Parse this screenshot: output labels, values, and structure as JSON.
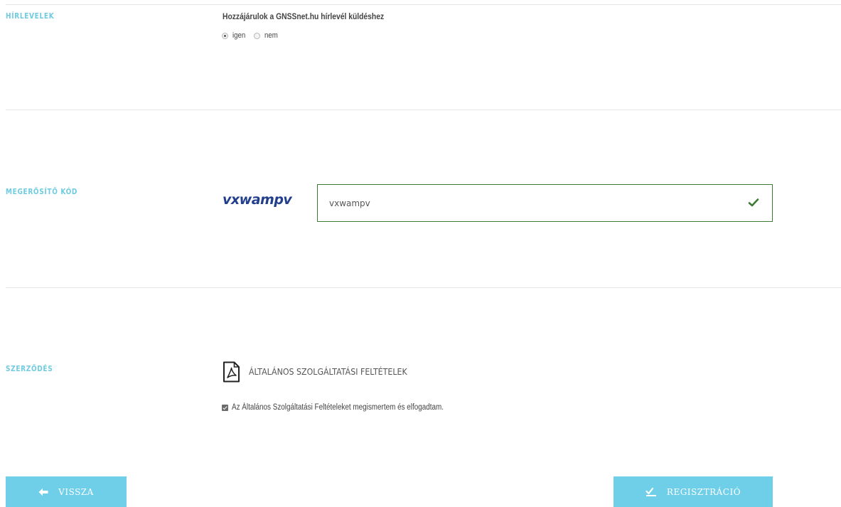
{
  "sections": {
    "newsletter": {
      "title": "HÍRLEVELEK",
      "consent_label": "Hozzájárulok a GNSSnet.hu hírlevél küldéshez",
      "options": [
        "igen",
        "nem"
      ],
      "selected": "igen"
    },
    "captcha": {
      "title": "MEGERŐSÍTŐ KÓD",
      "image_text": "vxwampv",
      "input_value": "vxwampv",
      "valid": true,
      "icon": "check-icon"
    },
    "contract": {
      "title": "SZERZŐDÉS",
      "terms_link": "ÁLTALÁNOS SZOLGÁLTATÁSI FELTÉTELEK",
      "terms_icon": "pdf-icon",
      "accept_label": "Az Általános Szolgáltatási Feltételeket megismertem és elfogadtam.",
      "accepted": true
    }
  },
  "buttons": {
    "back_label": "VISSZA",
    "back_icon": "arrow-left-icon",
    "register_label": "REGISZTRÁCIÓ",
    "register_icon": "signature-icon"
  },
  "colors": {
    "accent": "#6fcbe0",
    "button_bg": "#6fcfe8",
    "valid_border": "#3d7b34",
    "captcha_text": "#223f8c"
  }
}
